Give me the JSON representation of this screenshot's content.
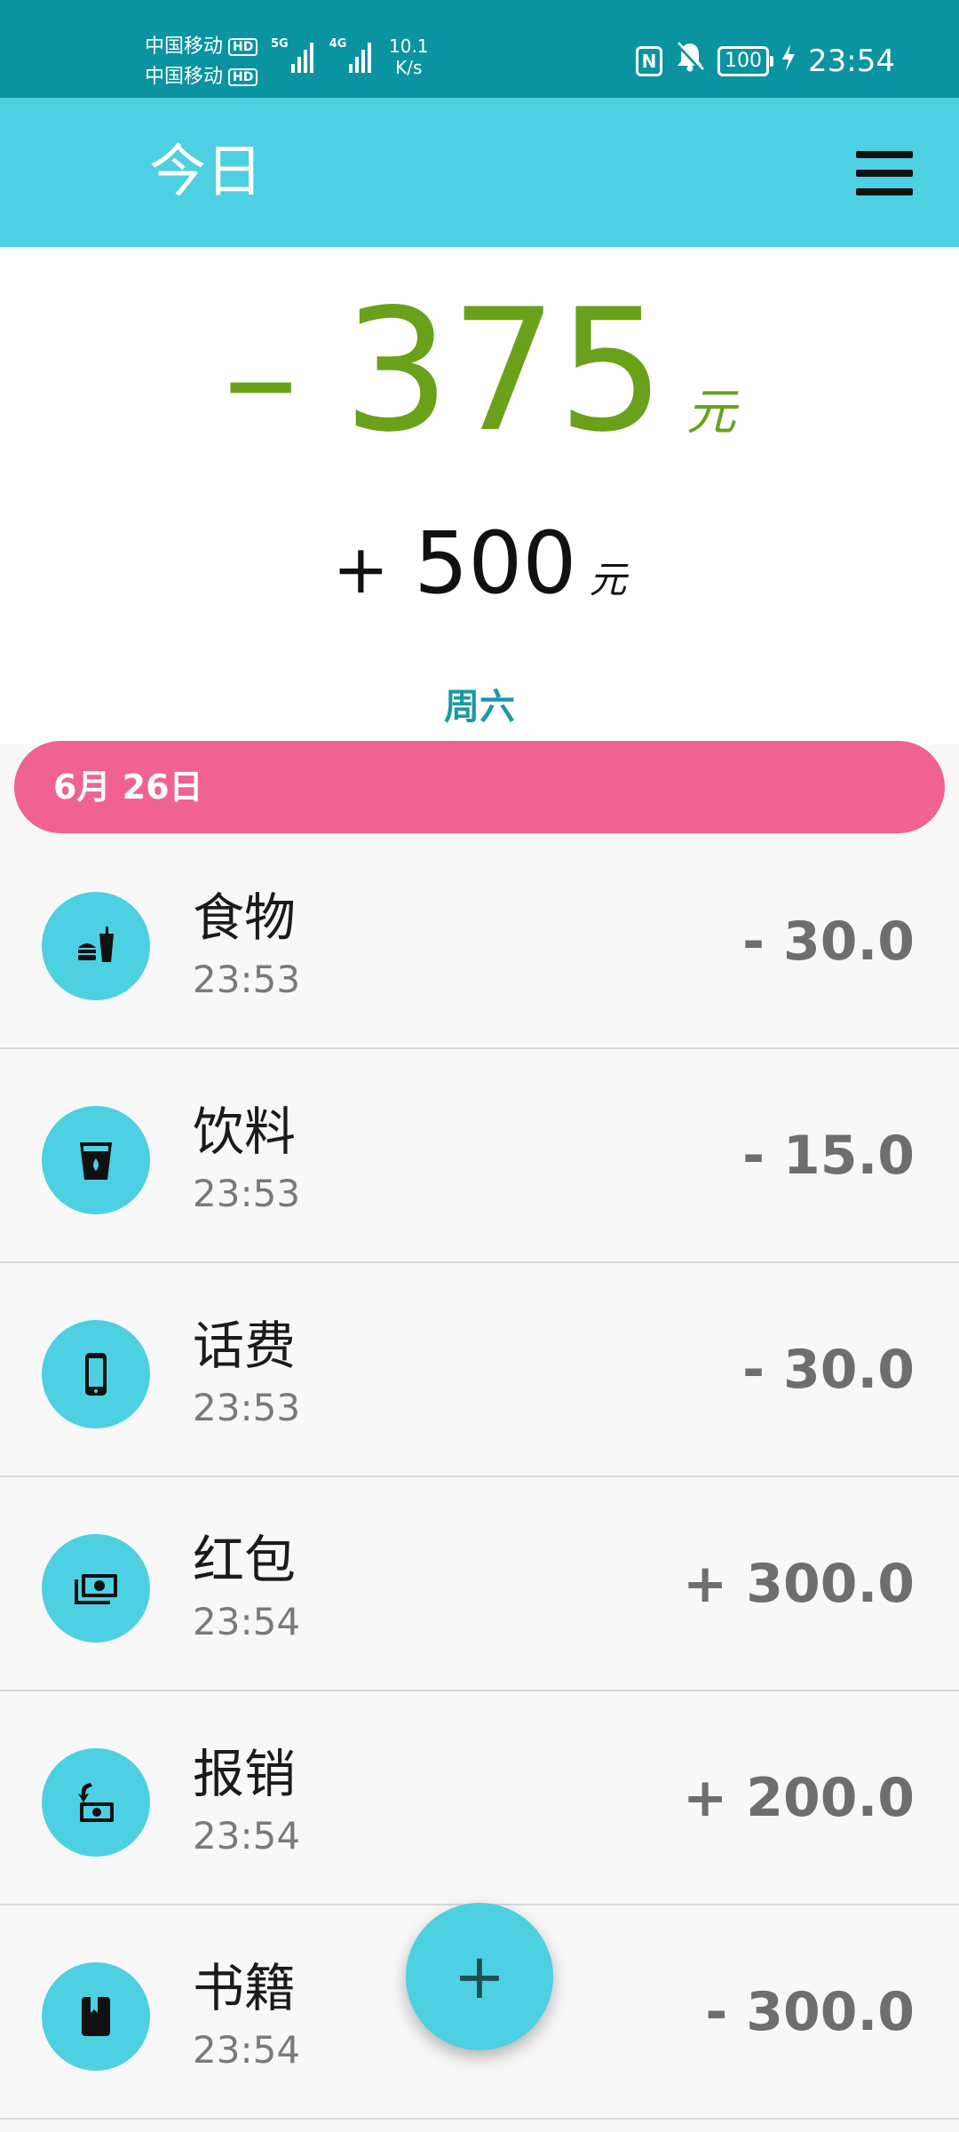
{
  "status_bar": {
    "carrier_1": "中国移动",
    "carrier_2": "中国移动",
    "hd": "HD",
    "signal_1_tag": "5G",
    "signal_2_tag": "4G",
    "net_speed_value": "10.1",
    "net_speed_unit": "K/s",
    "nfc": "N",
    "battery": "100",
    "time": "23:54"
  },
  "app_bar": {
    "title": "今日",
    "menu_icon": "hamburger-menu-icon"
  },
  "summary": {
    "expense_sign": "–",
    "expense_value": "375",
    "expense_unit": "元",
    "income_sign": "+",
    "income_value": "500",
    "income_unit": "元",
    "weekday": "周六",
    "accent_expense": "#6aa11a",
    "accent_weekday": "#1a98a8"
  },
  "date_header": {
    "label": "6月 26日",
    "color": "#f06292"
  },
  "entries": [
    {
      "name": "食物",
      "time": "23:53",
      "amount": "- 30.0",
      "icon": "food-drink-icon"
    },
    {
      "name": "饮料",
      "time": "23:53",
      "amount": "- 15.0",
      "icon": "beverage-cup-icon"
    },
    {
      "name": "话费",
      "time": "23:53",
      "amount": "- 30.0",
      "icon": "mobile-phone-icon"
    },
    {
      "name": "红包",
      "time": "23:54",
      "amount": "+ 300.0",
      "icon": "money-envelope-icon"
    },
    {
      "name": "报销",
      "time": "23:54",
      "amount": "+ 200.0",
      "icon": "reimburse-money-icon"
    },
    {
      "name": "书籍",
      "time": "23:54",
      "amount": "- 300.0",
      "icon": "book-icon"
    }
  ],
  "fab": {
    "label": "+",
    "icon": "add-icon"
  },
  "colors": {
    "status_bar": "#0a93a1",
    "app_bar": "#4dd0e1",
    "icon_circle": "#4dd0e1"
  }
}
